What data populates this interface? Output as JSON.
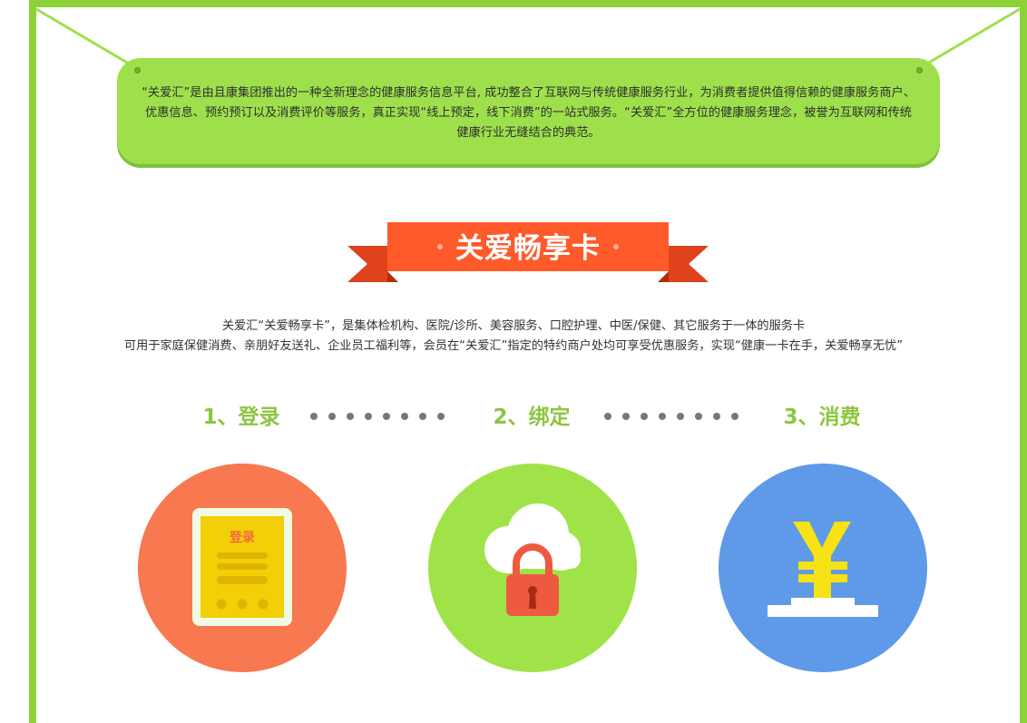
{
  "intro": {
    "text": "“关爱汇”是由且康集团推出的一种全新理念的健康服务信息平台, 成功整合了互联网与传统健康服务行业，为消费者提供值得信赖的健康服务商户、优惠信息、预约预订以及消费评价等服务，真正实现“线上预定，线下消费”的一站式服务。“关爱汇”全方位的健康服务理念，被誉为互联网和传统健康行业无缝结合的典范。"
  },
  "card": {
    "title": "关爱畅享卡"
  },
  "description": {
    "line1": "关爱汇“关爱畅享卡”，是集体检机构、医院/诊所、美容服务、口腔护理、中医/保健、其它服务于一体的服务卡",
    "line2": "可用于家庭保健消费、亲朋好友送礼、企业员工福利等，会员在“关爱汇”指定的特约商户处均可享受优惠服务，实现“健康一卡在手，关爱畅享无忧”"
  },
  "steps": [
    {
      "label": "1、登录",
      "icon": "login-card-icon",
      "color": "#f87850",
      "icon_text": "登录"
    },
    {
      "label": "2、绑定",
      "icon": "cloud-lock-icon",
      "color": "#a0e348"
    },
    {
      "label": "3、消费",
      "icon": "yen-icon",
      "color": "#5e9ae7"
    }
  ],
  "colors": {
    "frame": "#8dd338",
    "banner": "#9ee04c",
    "ribbon": "#ff5a2a",
    "step_label": "#8dc63f"
  }
}
